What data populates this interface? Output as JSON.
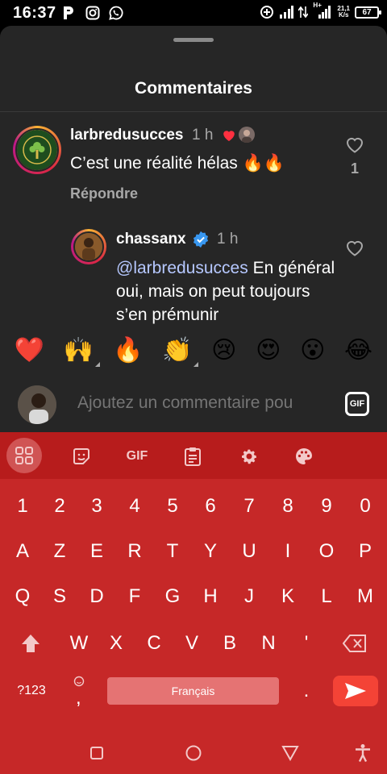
{
  "status_bar": {
    "time": "16:37",
    "net_speed_top": "21,1",
    "net_speed_bottom": "K/s",
    "network": "H+",
    "battery": "67"
  },
  "sheet": {
    "title": "Commentaires"
  },
  "comments": [
    {
      "username": "larbredusucces",
      "time": "1 h",
      "text": "C’est une réalité hélas 🔥🔥",
      "reply_label": "Répondre",
      "likes": "1"
    },
    {
      "username": "chassanx",
      "time": "1 h",
      "mention": "@larbredusucces",
      "text": " En général oui, mais on peut toujours s’en prémunir"
    }
  ],
  "emojis": [
    "❤️",
    "🙌",
    "🔥",
    "👏",
    "😢",
    "😍",
    "😮",
    "😂"
  ],
  "input": {
    "placeholder": "Ajoutez un commentaire pou",
    "gif_label": "GIF"
  },
  "keyboard": {
    "toolbar_gif": "GIF",
    "row_numbers": [
      "1",
      "2",
      "3",
      "4",
      "5",
      "6",
      "7",
      "8",
      "9",
      "0"
    ],
    "row1": [
      "A",
      "Z",
      "E",
      "R",
      "T",
      "Y",
      "U",
      "I",
      "O",
      "P"
    ],
    "row2": [
      "Q",
      "S",
      "D",
      "F",
      "G",
      "H",
      "J",
      "K",
      "L",
      "M"
    ],
    "row3": [
      "W",
      "X",
      "C",
      "V",
      "B",
      "N",
      "'"
    ],
    "sym_key": "?123",
    "comma_key": ",",
    "period_key": ".",
    "space_label": "Français"
  },
  "colors": {
    "sheet_bg": "#262626",
    "keyboard_bg": "#c62828",
    "accent_red": "#ff3040",
    "verified_blue": "#3897f0"
  }
}
